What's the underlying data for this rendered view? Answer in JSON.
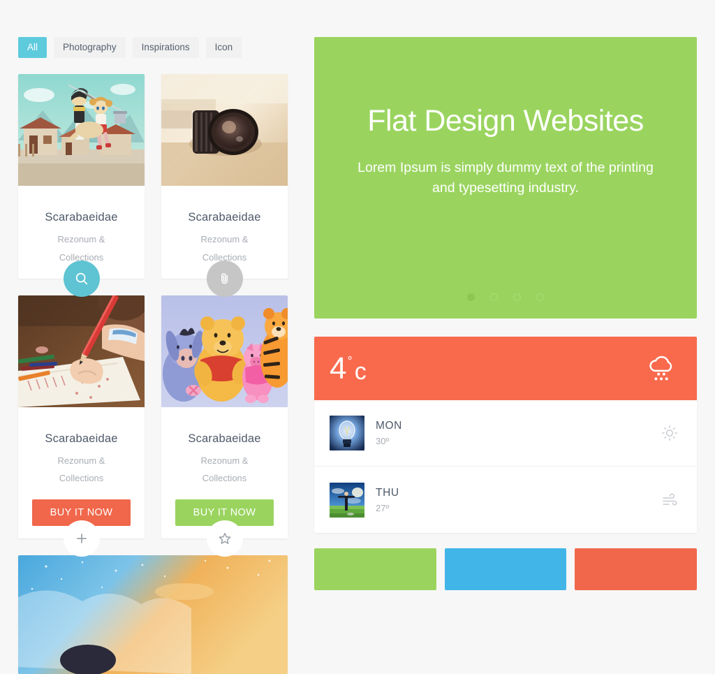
{
  "filters": {
    "tabs": [
      {
        "label": "All",
        "active": true
      },
      {
        "label": "Photography",
        "active": false
      },
      {
        "label": "Inspirations",
        "active": false
      },
      {
        "label": "Icon",
        "active": false
      }
    ]
  },
  "cards": [
    {
      "title": "Scarabaeidae",
      "subtitle": "Rezonum & Collections",
      "icon": "search-icon",
      "icon_style": "teal",
      "image": "anime-village-illustration",
      "has_buy_button": false,
      "buy_label": ""
    },
    {
      "title": "Scarabaeidae",
      "subtitle": "Rezonum & Collections",
      "icon": "paperclip-icon",
      "icon_style": "gray",
      "image": "camera-lens-photo",
      "has_buy_button": false,
      "buy_label": ""
    },
    {
      "title": "Scarabaeidae",
      "subtitle": "Rezonum & Collections",
      "icon": "plus-icon",
      "icon_style": "white",
      "image": "child-drawing-with-pencil-photo",
      "has_buy_button": true,
      "buy_label": "BUY IT NOW",
      "buy_color": "#f0674b"
    },
    {
      "title": "Scarabaeidae",
      "subtitle": "Rezonum & Collections",
      "icon": "star-icon",
      "icon_style": "white",
      "image": "winnie-the-pooh-characters-illustration",
      "has_buy_button": true,
      "buy_label": "BUY IT NOW",
      "buy_color": "#9ad45f"
    }
  ],
  "wide_card": {
    "image": "blue-orange-sky-fantasy-illustration"
  },
  "hero": {
    "title": "Flat Design Websites",
    "subtitle": "Lorem Ipsum is simply dummy text of the printing and typesetting industry.",
    "background_color": "#9ad45f",
    "dots": [
      {
        "active": true
      },
      {
        "active": false
      },
      {
        "active": false
      },
      {
        "active": false
      }
    ]
  },
  "weather": {
    "current": {
      "temperature": "4",
      "degree_symbol": "°",
      "unit": "c",
      "icon": "cloud-snow-icon",
      "background_color": "#f96a4d"
    },
    "forecast": [
      {
        "day": "MON",
        "temp": "30º",
        "icon": "sun-icon",
        "thumb": "light-bulb-photo"
      },
      {
        "day": "THU",
        "temp": "27º",
        "icon": "wind-icon",
        "thumb": "man-in-field-photo"
      }
    ]
  },
  "bottom_tiles": [
    {
      "color": "#9ad45f",
      "name": "green"
    },
    {
      "color": "#42b5e8",
      "name": "blue"
    },
    {
      "color": "#f0674b",
      "name": "orange"
    }
  ]
}
